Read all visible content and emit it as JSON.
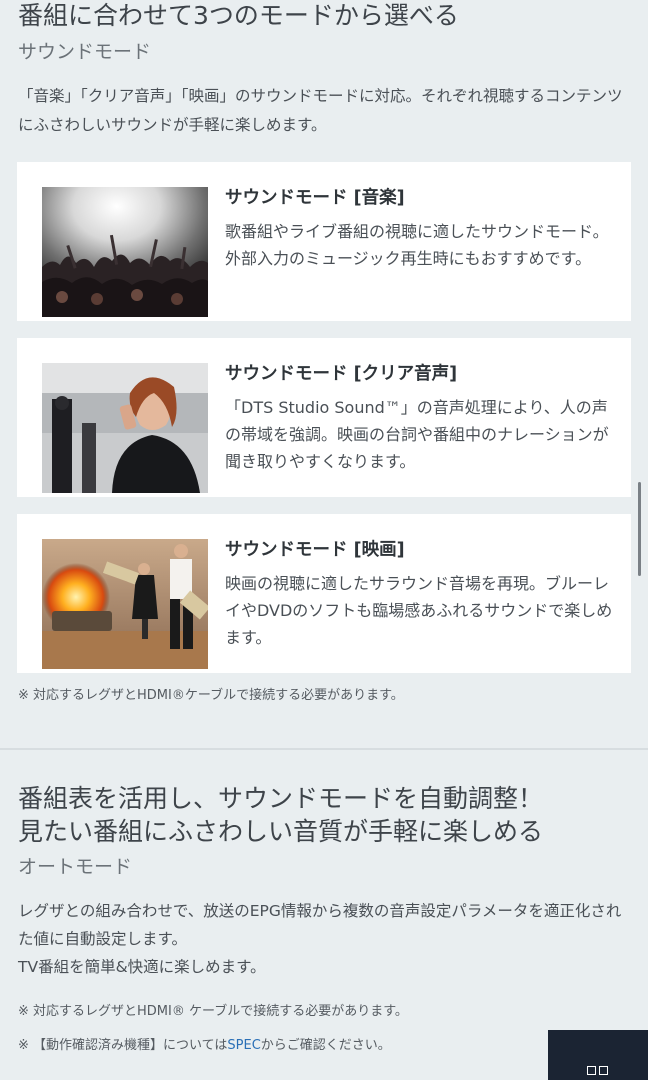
{
  "section_sound_mode": {
    "title": "番組に合わせて3つのモードから選べる",
    "subtitle": "サウンドモード",
    "intro": "「音楽」「クリア音声」「映画」のサウンドモードに対応。それぞれ視聴するコンテンツにふさわしいサウンドが手軽に楽しめます。",
    "cards": [
      {
        "title": "サウンドモード [音楽]",
        "description": "歌番組やライブ番組の視聴に適したサウンドモード。外部入力のミュージック再生時にもおすすめです。"
      },
      {
        "title": "サウンドモード [クリア音声]",
        "description": "「DTS Studio Sound™」の音声処理により、人の声の帯域を強調。映画の台詞や番組中のナレーションが聞き取りやすくなります。"
      },
      {
        "title": "サウンドモード [映画]",
        "description": "映画の視聴に適したサラウンド音場を再現。ブルーレイやDVDのソフトも臨場感あふれるサウンドで楽しめます。"
      }
    ],
    "note": "※ 対応するレグザとHDMI®ケーブルで接続する必要があります。"
  },
  "section_auto_mode": {
    "title_line1": "番組表を活用し、サウンドモードを自動調整！",
    "title_line2": "見たい番組にふさわしい音質が手軽に楽しめる",
    "subtitle": "オートモード",
    "description_line1": "レグザとの組み合わせで、放送のEPG情報から複数の音声設定パラメータを適正化された値に自動設定します。",
    "description_line2": "TV番組を簡単&快適に楽しめます。",
    "note1": "※ 対応するレグザとHDMI® ケーブルで接続する必要があります。",
    "note2_prefix": "※ 【動作確認済み機種】については",
    "note2_link": "SPEC",
    "note2_suffix": "からご確認ください。"
  }
}
